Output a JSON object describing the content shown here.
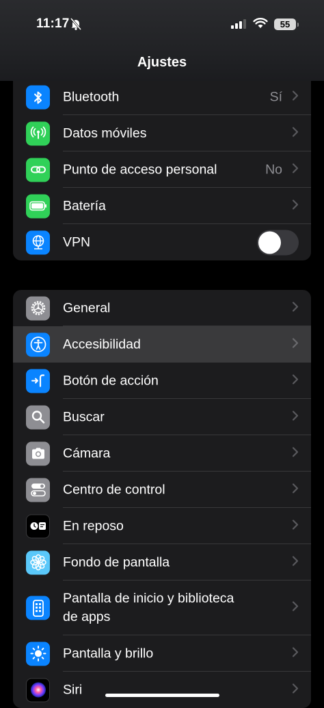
{
  "status": {
    "time": "11:17",
    "battery": "55"
  },
  "nav": {
    "title": "Ajustes"
  },
  "group1": [
    {
      "label": "Bluetooth",
      "value": "Sí",
      "icon": "bluetooth-icon",
      "color": "#0a84ff"
    },
    {
      "label": "Datos móviles",
      "value": "",
      "icon": "antenna-icon",
      "color": "#30d158"
    },
    {
      "label": "Punto de acceso personal",
      "value": "No",
      "icon": "hotspot-icon",
      "color": "#30d158"
    },
    {
      "label": "Batería",
      "value": "",
      "icon": "battery-icon",
      "color": "#30d158"
    },
    {
      "label": "VPN",
      "value": "",
      "icon": "globe-icon",
      "color": "#0a84ff"
    }
  ],
  "group2": [
    {
      "label": "General",
      "icon": "gear-icon",
      "color": "#8e8e93"
    },
    {
      "label": "Accesibilidad",
      "icon": "accessibility-icon",
      "color": "#0a84ff"
    },
    {
      "label": "Botón de acción",
      "icon": "action-button-icon",
      "color": "#0a84ff"
    },
    {
      "label": "Buscar",
      "icon": "search-icon",
      "color": "#8e8e93"
    },
    {
      "label": "Cámara",
      "icon": "camera-icon",
      "color": "#8e8e93"
    },
    {
      "label": "Centro de control",
      "icon": "control-center-icon",
      "color": "#8e8e93"
    },
    {
      "label": "En reposo",
      "icon": "standby-icon",
      "color": "#000000"
    },
    {
      "label": "Fondo de pantalla",
      "icon": "flower-icon",
      "color": "#5ac8fa"
    },
    {
      "label": "Pantalla de inicio y biblioteca de apps",
      "icon": "home-screen-icon",
      "color": "#0a84ff"
    },
    {
      "label": "Pantalla y brillo",
      "icon": "sun-icon",
      "color": "#0a84ff"
    },
    {
      "label": "Siri",
      "icon": "siri-icon",
      "color": "#000000"
    }
  ]
}
